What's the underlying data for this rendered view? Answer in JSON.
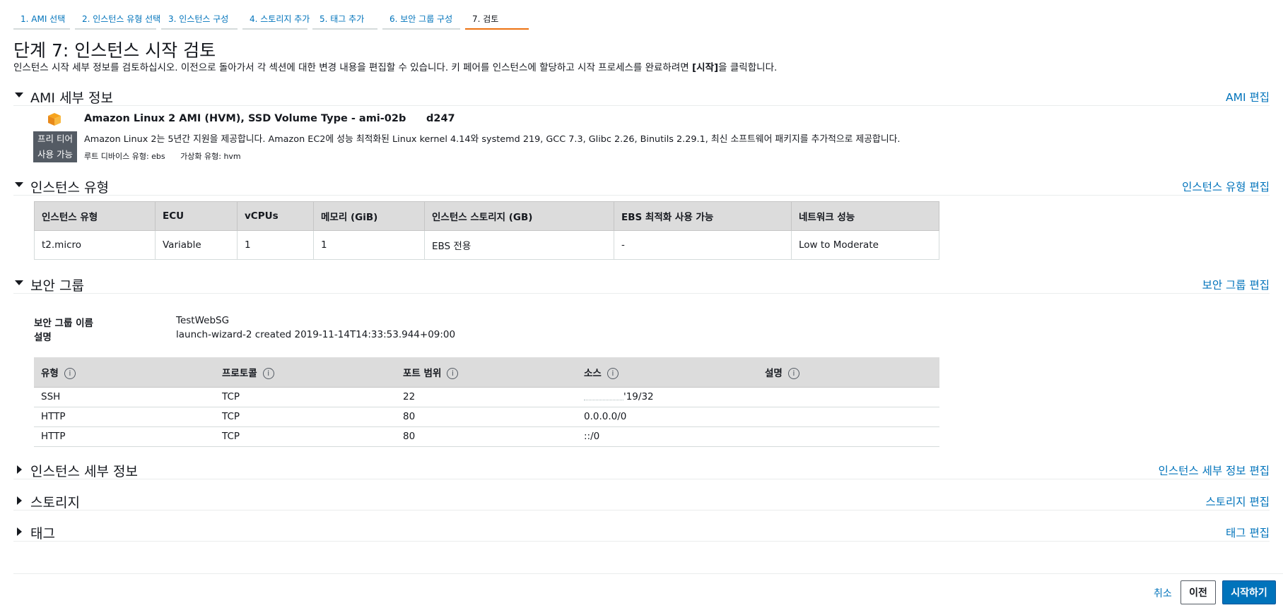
{
  "steps": [
    {
      "label": "1. AMI 선택"
    },
    {
      "label": "2. 인스턴스 유형 선택"
    },
    {
      "label": "3. 인스턴스 구성"
    },
    {
      "label": "4. 스토리지 추가"
    },
    {
      "label": "5. 태그 추가"
    },
    {
      "label": "6. 보안 그룹 구성"
    },
    {
      "label": "7. 검토",
      "active": true
    }
  ],
  "page": {
    "title": "단계 7: 인스턴스 시작 검토",
    "desc_pre": "인스턴스 시작 세부 정보를 검토하십시오. 이전으로 돌아가서 각 섹션에 대한 변경 내용을 편집할 수 있습니다. 키 페어를 인스턴스에 할당하고 시작 프로세스를 완료하려면 ",
    "desc_bold": "[시작]",
    "desc_post": "을 클릭합니다."
  },
  "ami": {
    "section_title": "AMI 세부 정보",
    "edit_label": "AMI 편집",
    "name": "Amazon Linux 2 AMI (HVM), SSD Volume Type - ami-02b",
    "id_tail": "d247",
    "description": "Amazon Linux 2는 5년간 지원을 제공합니다. Amazon EC2에 성능 최적화된 Linux kernel 4.14와 systemd 219, GCC 7.3, Glibc 2.26, Binutils 2.29.1, 최신 소프트웨어 패키지를 추가적으로 제공합니다.",
    "root_device": "루트 디바이스 유형: ebs",
    "virtualization": "가상화 유형: hvm",
    "free_tier_line1": "프리 티어",
    "free_tier_line2": "사용 가능",
    "icon": "aws-cube-icon",
    "icon_color": "#f7a41d"
  },
  "instance_type": {
    "section_title": "인스턴스 유형",
    "edit_label": "인스턴스 유형 편집",
    "headers": [
      "인스턴스 유형",
      "ECU",
      "vCPUs",
      "메모리 (GiB)",
      "인스턴스 스토리지 (GB)",
      "EBS 최적화 사용 가능",
      "네트워크 성능"
    ],
    "row": [
      "t2.micro",
      "Variable",
      "1",
      "1",
      "EBS 전용",
      "-",
      "Low to Moderate"
    ]
  },
  "security_group": {
    "section_title": "보안 그룹",
    "edit_label": "보안 그룹 편집",
    "name_label": "보안 그룹 이름",
    "name_value": "TestWebSG",
    "desc_label": "설명",
    "desc_value": "launch-wizard-2 created 2019-11-14T14:33:53.944+09:00",
    "headers": [
      "유형",
      "프로토콜",
      "포트 범위",
      "소스",
      "설명"
    ],
    "rows": [
      [
        "SSH",
        "TCP",
        "22",
        "'19/32",
        ""
      ],
      [
        "HTTP",
        "TCP",
        "80",
        "0.0.0.0/0",
        ""
      ],
      [
        "HTTP",
        "TCP",
        "80",
        "::/0",
        ""
      ]
    ]
  },
  "collapsed_sections": {
    "instance_details": {
      "title": "인스턴스 세부 정보",
      "edit_label": "인스턴스 세부 정보 편집"
    },
    "storage": {
      "title": "스토리지",
      "edit_label": "스토리지 편집"
    },
    "tags": {
      "title": "태그",
      "edit_label": "태그 편집"
    }
  },
  "footer": {
    "cancel": "취소",
    "previous": "이전",
    "launch": "시작하기"
  },
  "colors": {
    "link": "#0073bb",
    "active_tab": "#ec7211",
    "primary_button": "#0073bb"
  }
}
